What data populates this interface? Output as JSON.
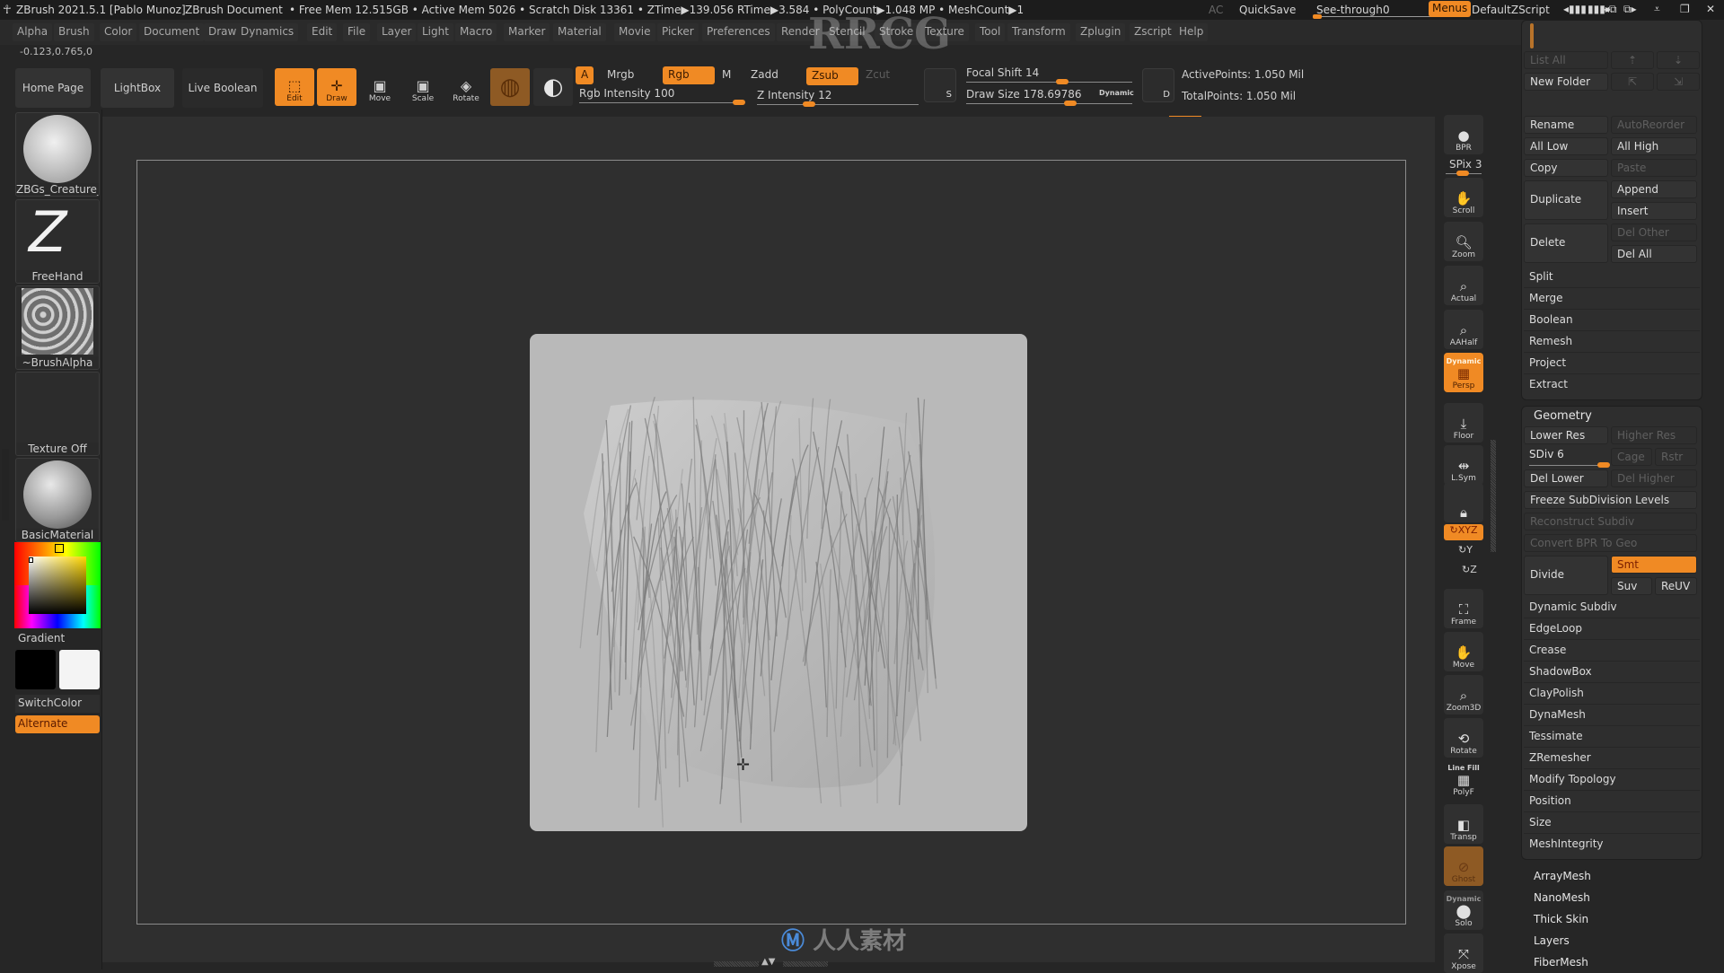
{
  "title_bar": {
    "app_title": "ZBrush 2021.5.1 [Pablo Munoz]",
    "document": "ZBrush Document",
    "stats": "• Free Mem 12.515GB • Active Mem 5026 • Scratch Disk 13361 • ZTime▶139.056 RTime▶3.584 • PolyCount▶1.048 MP • MeshCount▶1",
    "ac": "AC",
    "quicksave": "QuickSave",
    "see_through_label": "See-through",
    "see_through_value": "0",
    "menus": "Menus",
    "default_zscript": "DefaultZScript",
    "icons": [
      "interface-transparency-left-icon",
      "interface-transparency-right-icon",
      "doc-prev-icon",
      "doc-next-icon",
      "minimize-icon",
      "restore-icon",
      "close-icon"
    ]
  },
  "menubar": {
    "items": [
      "Alpha",
      "Brush",
      "Color",
      "Document",
      "Draw",
      "Dynamics",
      "Edit",
      "File",
      "Layer",
      "Light",
      "Macro",
      "Marker",
      "Material",
      "Movie",
      "Picker",
      "Preferences",
      "Render",
      "Stencil",
      "Stroke",
      "Texture",
      "Tool",
      "Transform",
      "Zplugin",
      "Zscript",
      "Help"
    ]
  },
  "coords": "-0.123,0.765,0",
  "shelf": {
    "home_page": "Home Page",
    "lightbox": "LightBox",
    "live_boolean": "Live Boolean",
    "tools": [
      {
        "label": "Edit",
        "active": true
      },
      {
        "label": "Draw",
        "active": true
      },
      {
        "label": "Move",
        "active": false
      },
      {
        "label": "Scale",
        "active": false
      },
      {
        "label": "Rotate",
        "active": false
      }
    ],
    "a_label": "A",
    "mrgb": "Mrgb",
    "rgb": "Rgb",
    "m": "M",
    "rgb_intensity": "Rgb Intensity 100",
    "rgb_intensity_value": 100,
    "zadd": "Zadd",
    "zsub": "Zsub",
    "zcut": "Zcut",
    "z_intensity": "Z Intensity 12",
    "z_intensity_value": 12,
    "s_label": "S",
    "focal_shift": "Focal Shift 14",
    "focal_shift_value": 14,
    "draw_size": "Draw Size 178.69786",
    "draw_size_value": 178.69786,
    "dynamic": "Dynamic",
    "d_label": "D",
    "active_points": "ActivePoints: 1.050 Mil",
    "total_points": "TotalPoints: 1.050 Mil"
  },
  "left_shelf": {
    "brush": "ZBGs_Creature_l",
    "stroke": "FreeHand",
    "alpha": "~BrushAlpha",
    "texture": "Texture Off",
    "material": "BasicMaterial",
    "gradient": "Gradient",
    "switch_color": "SwitchColor",
    "alternate": "Alternate",
    "main_color": "#000000",
    "secondary_color": "#f4f4f4"
  },
  "right_shelf": {
    "bpr": "BPR",
    "spix": "SPix 3",
    "spix_value": 3,
    "buttons": [
      "Scroll",
      "Zoom",
      "Actual",
      "AAHalf"
    ],
    "persp": "Persp",
    "persp_dynamic": "Dynamic",
    "floor": "Floor",
    "lsym": "L.Sym",
    "xyz": "XYZ",
    "y": "Y",
    "z": "Z",
    "frame": "Frame",
    "move": "Move",
    "zoom3d": "Zoom3D",
    "rotate": "Rotate",
    "line_fill": "Line Fill",
    "polyf": "PolyF",
    "transp": "Transp",
    "ghost": "Ghost",
    "solo_dynamic": "Dynamic",
    "solo": "Solo",
    "xpose": "Xpose"
  },
  "tool_palette": {
    "subtool": {
      "list_all": "List All",
      "new_folder": "New Folder",
      "rename": "Rename",
      "auto_reorder": "AutoReorder",
      "all_low": "All Low",
      "all_high": "All High",
      "copy": "Copy",
      "paste": "Paste",
      "duplicate": "Duplicate",
      "append": "Append",
      "insert": "Insert",
      "delete": "Delete",
      "del_other": "Del Other",
      "del_all": "Del All",
      "rows": [
        "Split",
        "Merge",
        "Boolean",
        "Remesh",
        "Project",
        "Extract"
      ]
    },
    "geometry": {
      "title": "Geometry",
      "lower_res": "Lower Res",
      "higher_res": "Higher Res",
      "sdiv": "SDiv 6",
      "sdiv_value": 6,
      "cage": "Cage",
      "rstr": "Rstr",
      "del_lower": "Del Lower",
      "del_higher": "Del Higher",
      "freeze": "Freeze SubDivision Levels",
      "reconstruct": "Reconstruct Subdiv",
      "convert_bpr": "Convert BPR To Geo",
      "divide": "Divide",
      "smt": "Smt",
      "suv": "Suv",
      "reuv": "ReUV",
      "rows": [
        "Dynamic Subdiv",
        "EdgeLoop",
        "Crease",
        "ShadowBox",
        "ClayPolish",
        "DynaMesh",
        "Tessimate",
        "ZRemesher",
        "Modify Topology",
        "Position",
        "Size",
        "MeshIntegrity"
      ]
    },
    "closed_sections": [
      "ArrayMesh",
      "NanoMesh",
      "Thick Skin",
      "Layers",
      "FiberMesh"
    ]
  },
  "watermark": {
    "text": "RRCG",
    "bottom_logo": "人人素材"
  },
  "colors": {
    "accent": "#f08a24",
    "background": "#262626",
    "canvas": "#2f2f2f",
    "document": "#b9b9b9"
  }
}
